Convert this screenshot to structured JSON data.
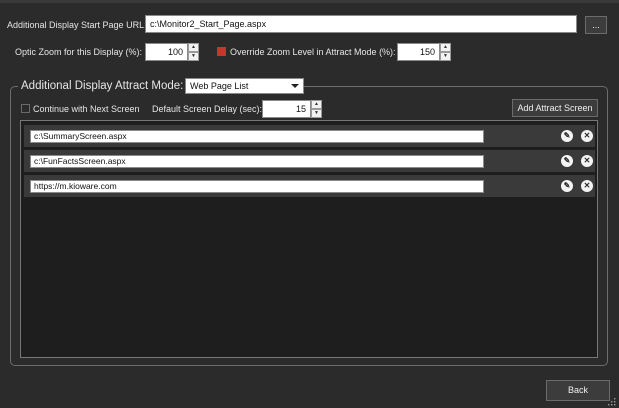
{
  "start_page": {
    "label": "Additional Display Start Page URL:",
    "value": "c:\\Monitor2_Start_Page.aspx",
    "browse_label": "..."
  },
  "zoom": {
    "label": "Optic Zoom for this Display (%):",
    "value": "100",
    "override_label": "Override Zoom Level in Attract Mode (%):",
    "override_value": "150",
    "override_checked": true
  },
  "attract": {
    "group_label": "Additional Display Attract Mode:",
    "mode": "Web Page List",
    "continue_label": "Continue with Next Screen",
    "continue_checked": false,
    "delay_label": "Default Screen Delay (sec):",
    "delay_value": "15",
    "add_button": "Add Attract Screen",
    "screens": [
      {
        "url": "c:\\SummaryScreen.aspx"
      },
      {
        "url": "c:\\FunFactsScreen.aspx"
      },
      {
        "url": "https://m.kioware.com"
      }
    ]
  },
  "footer": {
    "back_label": "Back"
  },
  "colors": {
    "background": "#2b2b2b",
    "check_active": "#c0392b",
    "row_bg": "#3a3a3a",
    "list_bg": "#1e1e1e"
  },
  "icons": {
    "edit": "pencil-icon",
    "delete": "close-circle-icon"
  }
}
